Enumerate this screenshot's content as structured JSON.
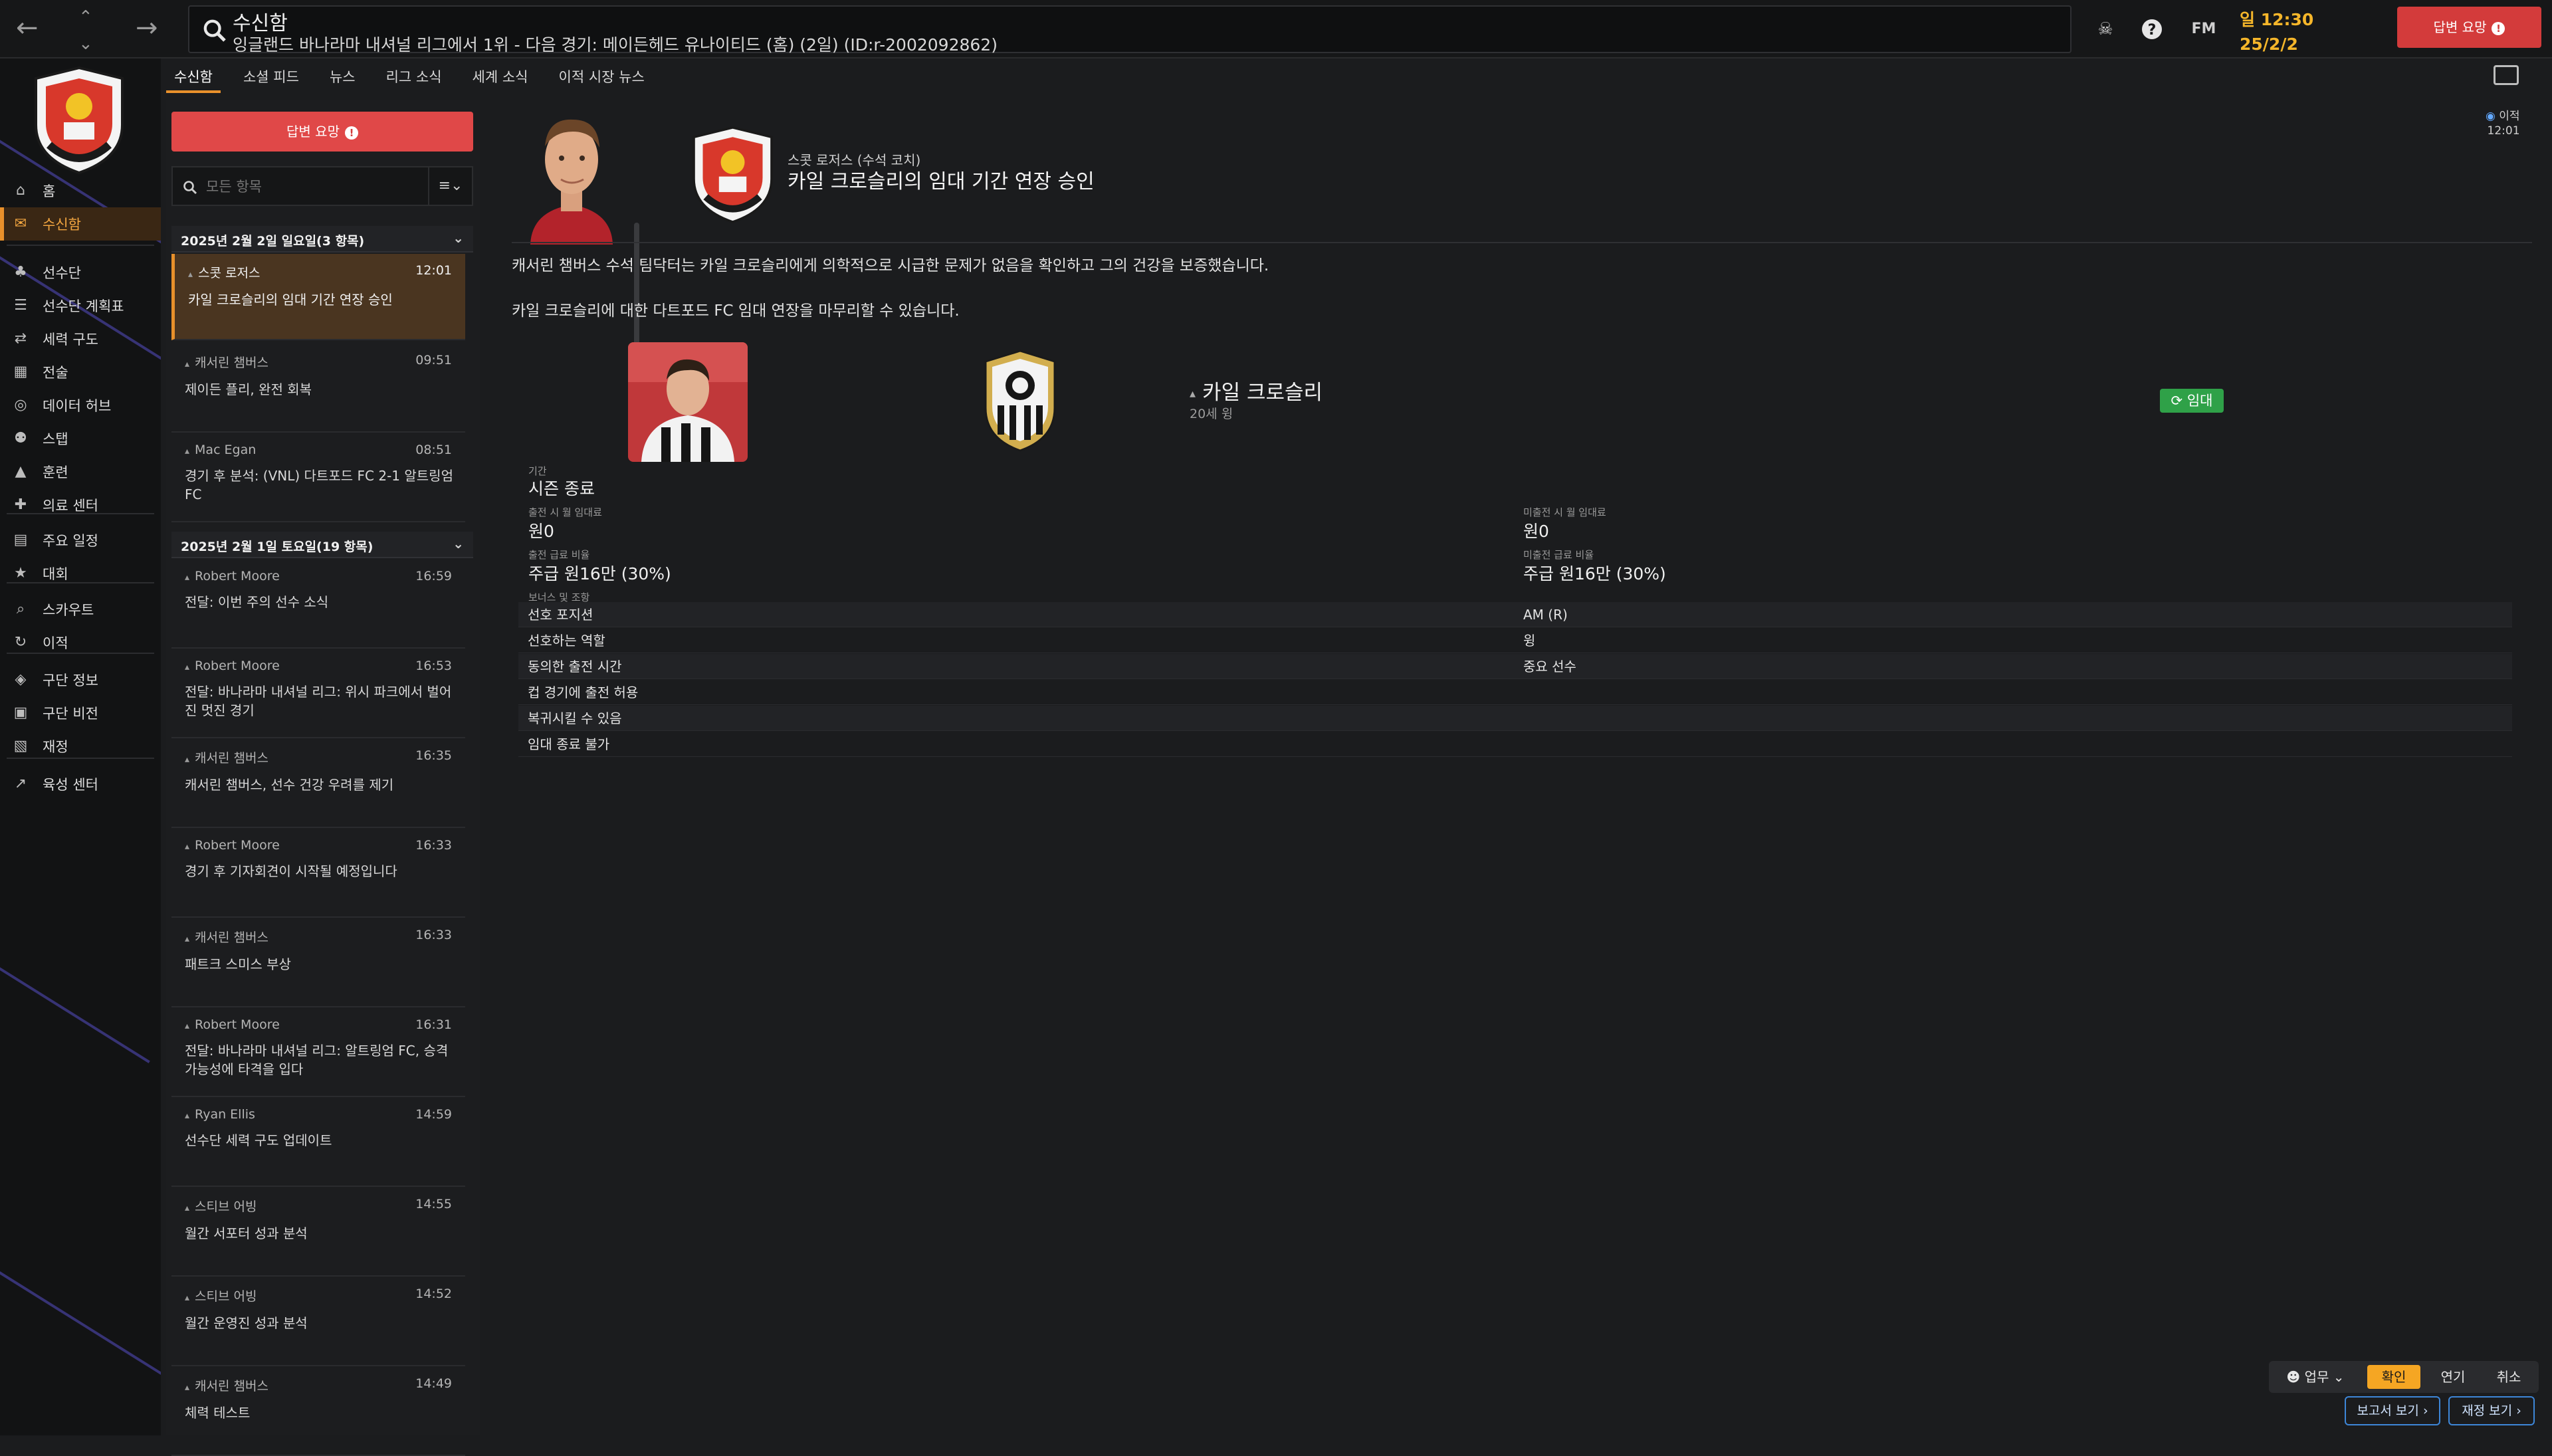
{
  "window": {
    "title": "수신함",
    "subtitle": "잉글랜드 바나라마 내셔널 리그에서 1위 - 다음 경기: 메이든헤드 유나이티드 (홈) (2일) (ID:r-2002092862)",
    "time": "일 12:30",
    "date": "25/2/2",
    "reply_label": "답변 요망",
    "fm_label": "FM"
  },
  "sidebar": {
    "items": [
      {
        "label": "홈",
        "icon": "home-icon"
      },
      {
        "label": "수신함",
        "icon": "inbox-icon"
      },
      {
        "label": "선수단",
        "icon": "shirt-icon"
      },
      {
        "label": "선수단 계획표",
        "icon": "clipboard-icon"
      },
      {
        "label": "세력 구도",
        "icon": "network-icon"
      },
      {
        "label": "전술",
        "icon": "tactics-icon"
      },
      {
        "label": "데이터 허브",
        "icon": "data-icon"
      },
      {
        "label": "스탭",
        "icon": "staff-icon"
      },
      {
        "label": "훈련",
        "icon": "training-icon"
      },
      {
        "label": "의료 센터",
        "icon": "medical-icon"
      },
      {
        "label": "주요 일정",
        "icon": "calendar-icon"
      },
      {
        "label": "대회",
        "icon": "trophy-icon"
      },
      {
        "label": "스카우트",
        "icon": "scout-icon"
      },
      {
        "label": "이적",
        "icon": "transfer-icon"
      },
      {
        "label": "구단 정보",
        "icon": "shield-icon"
      },
      {
        "label": "구단 비전",
        "icon": "vision-icon"
      },
      {
        "label": "재정",
        "icon": "finance-icon"
      },
      {
        "label": "육성 센터",
        "icon": "development-icon"
      }
    ]
  },
  "tabs": [
    "수신함",
    "소셜 피드",
    "뉴스",
    "리그 소식",
    "세계 소식",
    "이적 시장 뉴스"
  ],
  "list": {
    "reply_label": "답변 요망",
    "filter_placeholder": "모든 항목",
    "groups": [
      {
        "header": "2025년 2월 2일 일요일(3 항목)"
      },
      {
        "header": "2025년 2월 1일 토요일(19 항목)"
      }
    ],
    "messages": [
      {
        "from": "스콧 로저스",
        "time": "12:01",
        "subject": "카일 크로슬리의 임대 기간 연장 승인"
      },
      {
        "from": "캐서린 챔버스",
        "time": "09:51",
        "subject": "제이든 플리, 완전 회복"
      },
      {
        "from": "Mac Egan",
        "time": "08:51",
        "subject": "경기 후 분석: (VNL) 다트포드 FC 2-1 알트링엄 FC"
      },
      {
        "from": "Robert Moore",
        "time": "16:59",
        "subject": "전달: 이번 주의 선수 소식"
      },
      {
        "from": "Robert Moore",
        "time": "16:53",
        "subject": "전달: 바나라마 내셔널 리그: 위시 파크에서 벌어진 멋진 경기"
      },
      {
        "from": "캐서린 챔버스",
        "time": "16:35",
        "subject": "캐서린 챔버스, 선수 건강 우려를 제기"
      },
      {
        "from": "Robert Moore",
        "time": "16:33",
        "subject": "경기 후 기자회견이 시작될 예정입니다"
      },
      {
        "from": "캐서린 챔버스",
        "time": "16:33",
        "subject": "패트크 스미스 부상"
      },
      {
        "from": "Robert Moore",
        "time": "16:31",
        "subject": "전달: 바나라마 내셔널 리그: 알트링엄 FC, 승격 가능성에 타격을 입다"
      },
      {
        "from": "Ryan Ellis",
        "time": "14:59",
        "subject": "선수단 세력 구도 업데이트"
      },
      {
        "from": "스티브 어빙",
        "time": "14:55",
        "subject": "월간 서포터 성과 분석"
      },
      {
        "from": "스티브 어빙",
        "time": "14:52",
        "subject": "월간 운영진 성과 분석"
      },
      {
        "from": "캐서린 챔버스",
        "time": "14:49",
        "subject": "체력 테스트"
      }
    ]
  },
  "message": {
    "sender": "스콧 로저스 (수석 코치)",
    "title": "카일 크로슬리의 임대 기간 연장 승인",
    "tag": "이적",
    "tag_time": "12:01",
    "body1": "캐서린 챔버스 수석 팀닥터는 카일 크로슬리에게 의학적으로 시급한 문제가 없음을 확인하고 그의 건강을 보증했습니다.",
    "body2": "카일 크로슬리에 대한 다트포드 FC 임대 연장을 마무리할 수 있습니다.",
    "player_name": "카일 크로슬리",
    "player_meta": "20세 윙",
    "loan_label": "임대",
    "duration_label": "기간",
    "duration_value": "시즌 종료",
    "fee_played_label": "출전 시 월 임대료",
    "fee_played_value": "원0",
    "fee_unplayed_label": "미출전 시 월 임대료",
    "fee_unplayed_value": "원0",
    "wage_played_label": "출전 급료 비율",
    "wage_played_value": "주급 원16만 (30%)",
    "wage_unplayed_label": "미출전 급료 비율",
    "wage_unplayed_value": "주급 원16만 (30%)",
    "terms_label": "보너스 및 조항",
    "terms": [
      {
        "k": "선호 포지션",
        "v": "AM (R)"
      },
      {
        "k": "선호하는 역할",
        "v": "윙"
      },
      {
        "k": "동의한 출전 시간",
        "v": "중요 선수"
      },
      {
        "k": "컵 경기에 출전 허용",
        "v": ""
      },
      {
        "k": "복귀시킬 수 있음",
        "v": ""
      },
      {
        "k": "임대 종료 불가",
        "v": ""
      }
    ]
  },
  "actions": {
    "work": "업무",
    "confirm": "확인",
    "postpone": "연기",
    "cancel": "취소",
    "report": "보고서 보기",
    "finance": "재정 보기"
  },
  "colors": {
    "accent": "#e8902b",
    "reply": "#e04848",
    "loan": "#2fa148",
    "link": "#3d86d8"
  }
}
